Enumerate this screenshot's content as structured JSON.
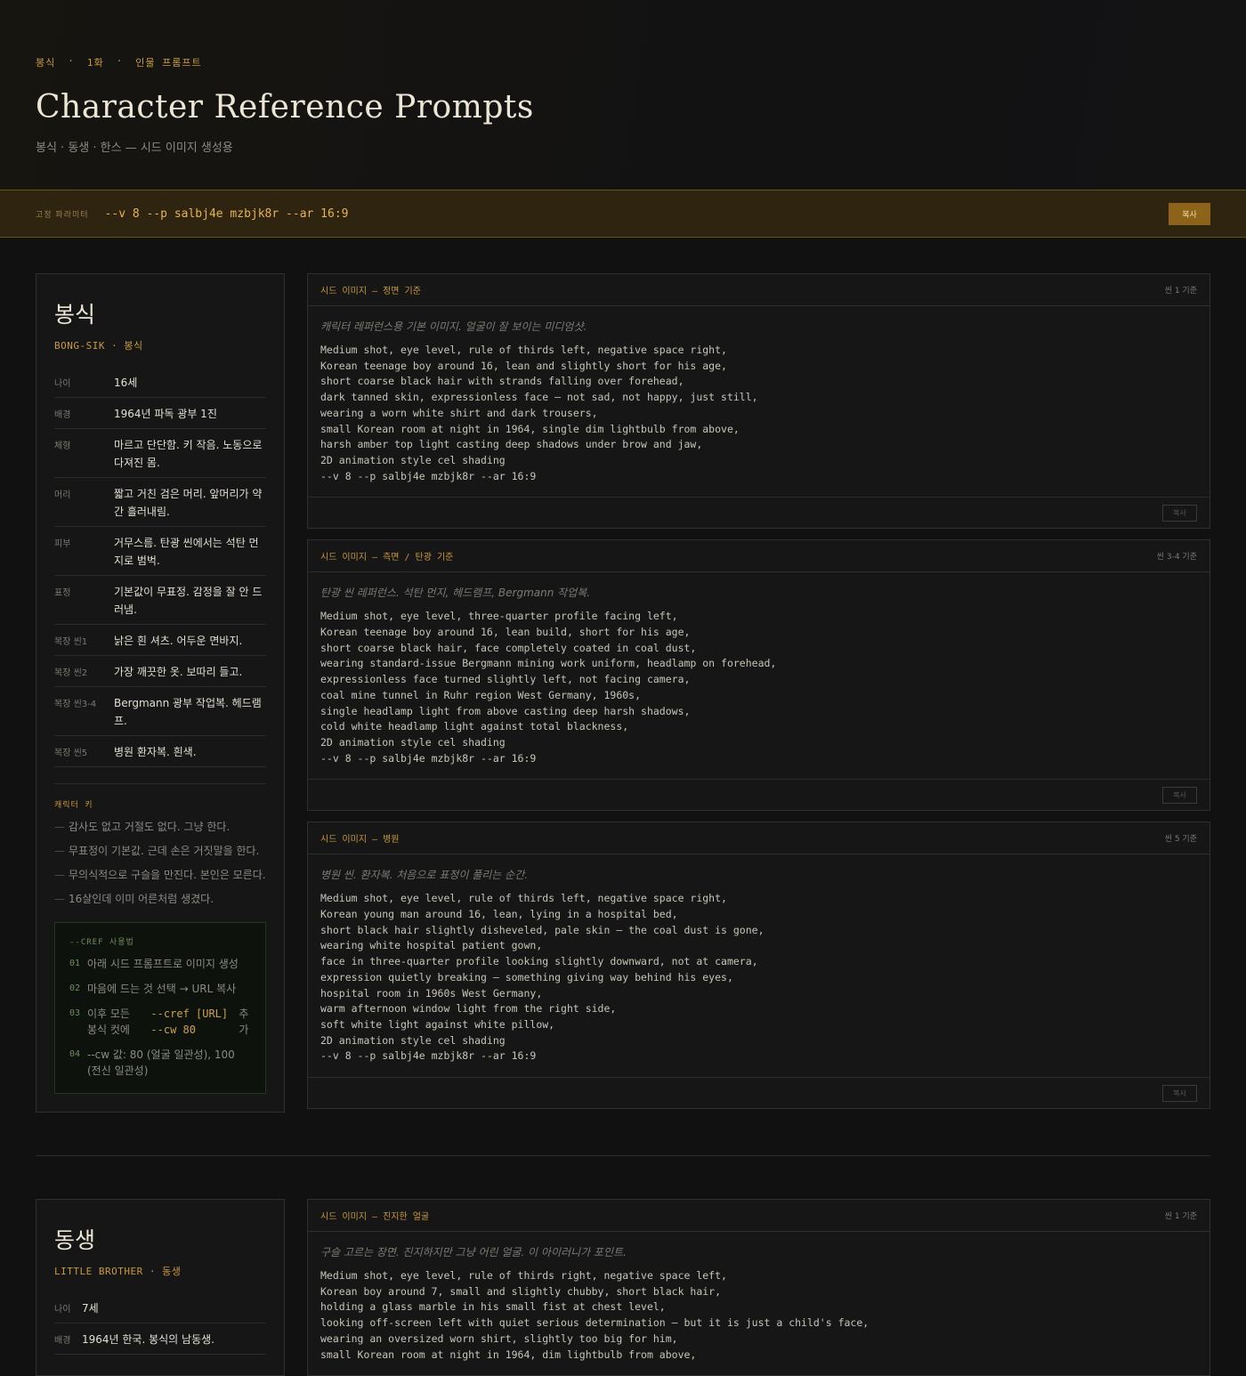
{
  "hero": {
    "breadcrumb": [
      "봉식",
      "·",
      "1화",
      "·",
      "인물 프롬프트"
    ],
    "title": "Character Reference Prompts",
    "subtitle": "봉식 · 동생 · 한스 — 시드 이미지 생성용"
  },
  "params": {
    "label": "고정 파라미터",
    "value": "--v 8 --p salbj4e mzbjk8r --ar 16:9",
    "copy_label": "복사"
  },
  "characters": [
    {
      "name": "봉식",
      "sub": "BONG-SIK · 봉식",
      "attrs": [
        {
          "k": "나이",
          "v": "16세"
        },
        {
          "k": "배경",
          "v": "1964년 파독 광부 1진"
        },
        {
          "k": "체형",
          "v": "마르고 단단함. 키 작음. 노동으로 다져진 몸."
        },
        {
          "k": "머리",
          "v": "짧고 거친 검은 머리. 앞머리가 약간 흘러내림."
        },
        {
          "k": "피부",
          "v": "거무스름. 탄광 씬에서는 석탄 먼지로 범벅."
        },
        {
          "k": "표정",
          "v": "기본값이 무표정. 감정을 잘 안 드러냄."
        },
        {
          "k": "복장 씬1",
          "v": "낡은 흰 셔츠. 어두운 면바지."
        },
        {
          "k": "복장 씬2",
          "v": "가장 깨끗한 옷. 보따리 들고."
        },
        {
          "k": "복장 씬3-4",
          "v": "Bergmann 광부 작업복. 헤드램프."
        },
        {
          "k": "복장 씬5",
          "v": "병원 환자복. 흰색."
        }
      ],
      "keys_title": "캐릭터 키",
      "keys": [
        "감사도 없고 거절도 없다. 그냥 한다.",
        "무표정이 기본값. 근데 손은 거짓말을 한다.",
        "무의식적으로 구슬을 만진다. 본인은 모른다.",
        "16살인데 이미 어른처럼 생겼다."
      ],
      "cref": {
        "title": "--CREF 사용법",
        "steps": [
          {
            "n": "01",
            "text": "아래 시드 프롬프트로 이미지 생성"
          },
          {
            "n": "02",
            "text": "마음에 드는 것 선택 → URL 복사"
          },
          {
            "n": "03",
            "text": "이후 모든 봉식 컷에",
            "code": "--cref [URL] --cw 80",
            "tail": "추가"
          },
          {
            "n": "04",
            "text": "--cw 값: 80 (얼굴 일관성), 100 (전신 일관성)"
          }
        ]
      },
      "prompts": [
        {
          "title": "시드 이미지 — 정면 기준",
          "scene": "씬 1 기준",
          "desc": "캐릭터 레퍼런스용 기본 이미지. 얼굴이 잘 보이는 미디엄샷.",
          "text": "Medium shot, eye level, rule of thirds left, negative space right,\nKorean teenage boy around 16, lean and slightly short for his age,\nshort coarse black hair with strands falling over forehead,\ndark tanned skin, expressionless face — not sad, not happy, just still,\nwearing a worn white shirt and dark trousers,\nsmall Korean room at night in 1964, single dim lightbulb from above,\nharsh amber top light casting deep shadows under brow and jaw,\n2D animation style cel shading\n--v 8 --p salbj4e mzbjk8r --ar 16:9",
          "copy": "복사"
        },
        {
          "title": "시드 이미지 — 측면 / 탄광 기준",
          "scene": "씬 3-4 기준",
          "desc": "탄광 씬 레퍼런스. 석탄 먼지, 헤드램프, Bergmann 작업복.",
          "text": "Medium shot, eye level, three-quarter profile facing left,\nKorean teenage boy around 16, lean build, short for his age,\nshort coarse black hair, face completely coated in coal dust,\nwearing standard-issue Bergmann mining work uniform, headlamp on forehead,\nexpressionless face turned slightly left, not facing camera,\ncoal mine tunnel in Ruhr region West Germany, 1960s,\nsingle headlamp light from above casting deep harsh shadows,\ncold white headlamp light against total blackness,\n2D animation style cel shading\n--v 8 --p salbj4e mzbjk8r --ar 16:9",
          "copy": "복사"
        },
        {
          "title": "시드 이미지 — 병원",
          "scene": "씬 5 기준",
          "desc": "병원 씬. 환자복. 처음으로 표정이 풀리는 순간.",
          "text": "Medium shot, eye level, rule of thirds left, negative space right,\nKorean young man around 16, lean, lying in a hospital bed,\nshort black hair slightly disheveled, pale skin — the coal dust is gone,\nwearing white hospital patient gown,\nface in three-quarter profile looking slightly downward, not at camera,\nexpression quietly breaking — something giving way behind his eyes,\nhospital room in 1960s West Germany,\nwarm afternoon window light from the right side,\nsoft white light against white pillow,\n2D animation style cel shading\n--v 8 --p salbj4e mzbjk8r --ar 16:9",
          "copy": "복사"
        }
      ]
    },
    {
      "name": "동생",
      "sub": "LITTLE BROTHER · 동생",
      "attrs": [
        {
          "k": "나이",
          "v": "7세"
        },
        {
          "k": "배경",
          "v": "1964년 한국. 봉식의 남동생."
        }
      ],
      "prompts": [
        {
          "title": "시드 이미지 — 진지한 얼굴",
          "scene": "씬 1 기준",
          "desc": "구슬 고르는 장면. 진지하지만 그냥 어린 얼굴. 이 아이러니가 포인트.",
          "text": "Medium shot, eye level, rule of thirds right, negative space left,\nKorean boy around 7, small and slightly chubby, short black hair,\nholding a glass marble in his small fist at chest level,\nlooking off-screen left with quiet serious determination — but it is just a child's face,\nwearing an oversized worn shirt, slightly too big for him,\nsmall Korean room at night in 1964, dim lightbulb from above,"
        }
      ]
    }
  ]
}
